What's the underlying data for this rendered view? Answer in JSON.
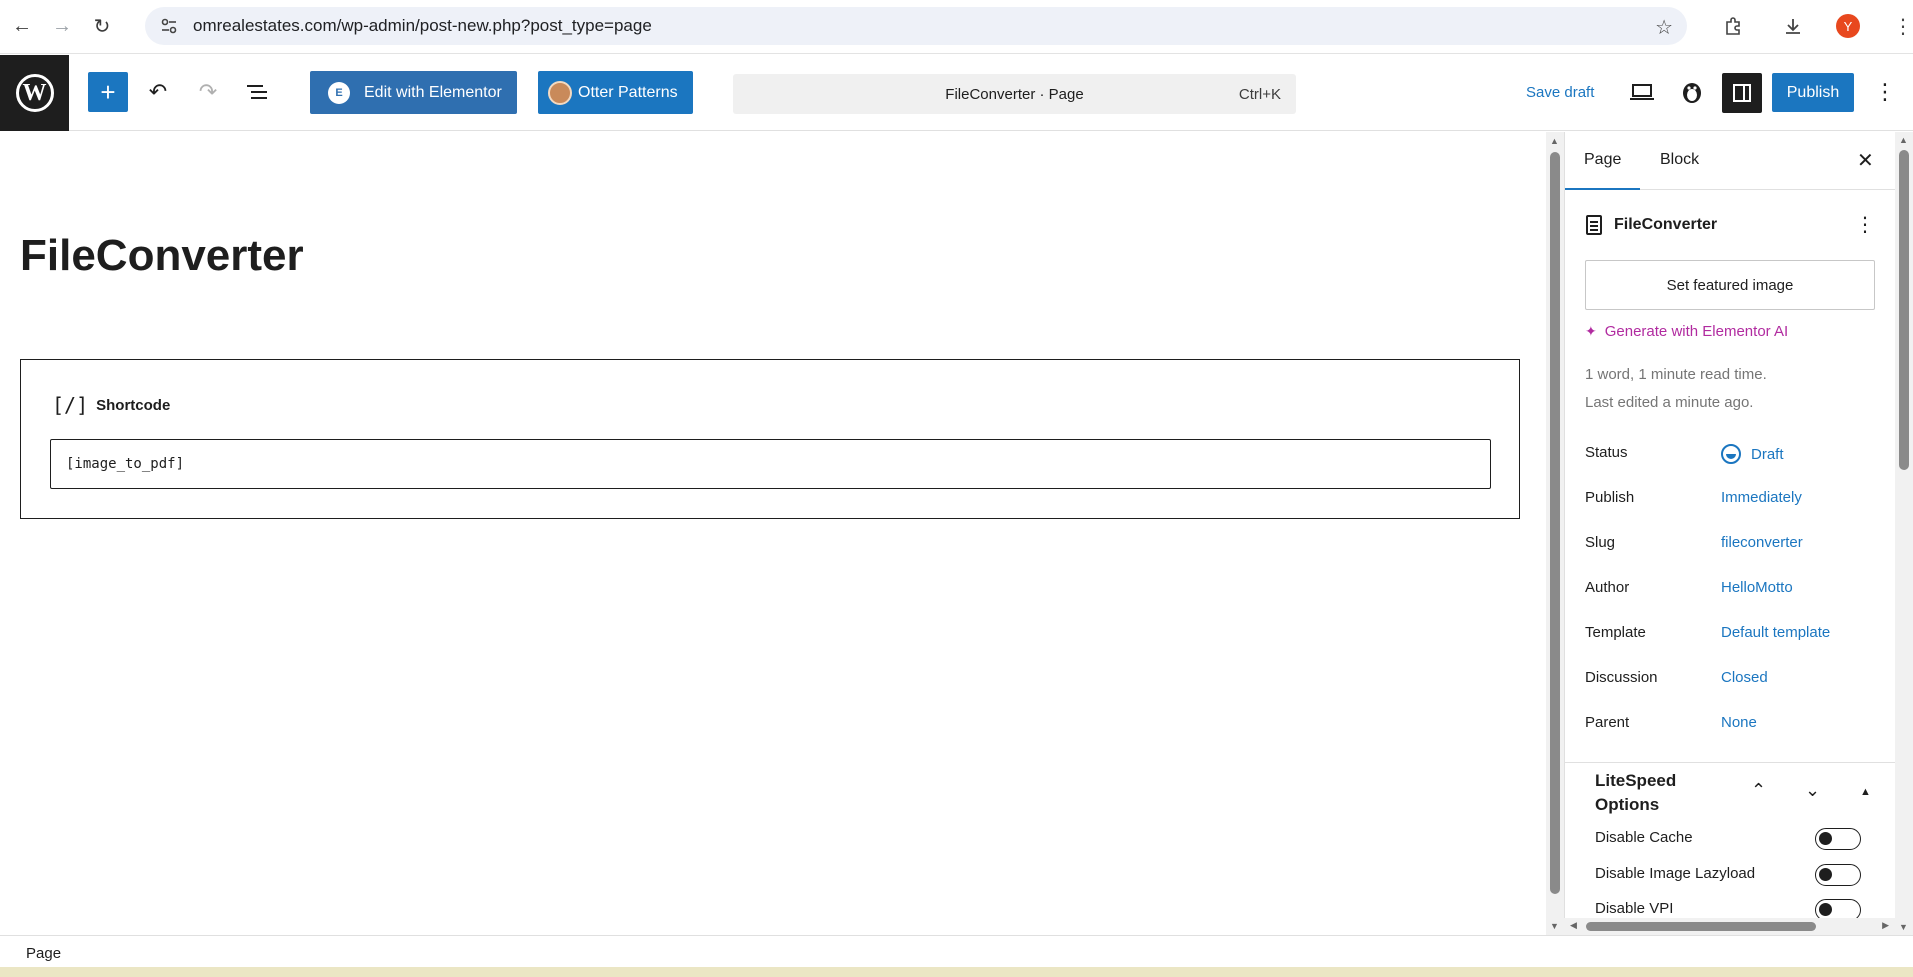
{
  "browser": {
    "url": "omrealestates.com/wp-admin/post-new.php?post_type=page",
    "profile_initial": "Y"
  },
  "header": {
    "elementor_label": "Edit with Elementor",
    "otter_label": "Otter Patterns",
    "doc_title": "FileConverter · Page",
    "shortcut": "Ctrl+K",
    "save_draft": "Save draft",
    "publish": "Publish"
  },
  "canvas": {
    "post_title": "FileConverter",
    "block_name": "Shortcode",
    "shortcode_value": "[image_to_pdf]"
  },
  "sidebar": {
    "tabs": [
      "Page",
      "Block"
    ],
    "doc_name": "FileConverter",
    "featured_image": "Set featured image",
    "generate_ai": "Generate with Elementor AI",
    "meta_words": "1 word, 1 minute read time.",
    "meta_edited": "Last edited a minute ago.",
    "rows": [
      {
        "label": "Status",
        "value": "Draft"
      },
      {
        "label": "Publish",
        "value": "Immediately"
      },
      {
        "label": "Slug",
        "value": "fileconverter"
      },
      {
        "label": "Author",
        "value": "HelloMotto"
      },
      {
        "label": "Template",
        "value": "Default template"
      },
      {
        "label": "Discussion",
        "value": "Closed"
      },
      {
        "label": "Parent",
        "value": "None"
      }
    ],
    "litespeed": {
      "title": "LiteSpeed Options",
      "options": [
        "Disable Cache",
        "Disable Image Lazyload",
        "Disable VPI"
      ]
    }
  },
  "footer": {
    "breadcrumb": "Page"
  },
  "colors": {
    "accent": "#1b76c0",
    "ai_magenta": "#b12ba0",
    "dark": "#1e1e1e"
  }
}
